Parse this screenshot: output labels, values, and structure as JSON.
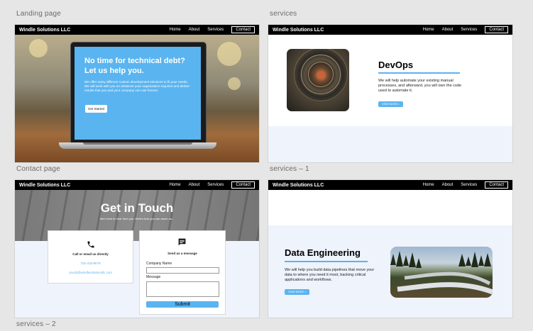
{
  "labels": {
    "landing": "Landing page",
    "services": "services",
    "contact": "Contact page",
    "services1": "services – 1",
    "services2": "services – 2"
  },
  "nav": {
    "brand": "Windle Solutions LLC",
    "home": "Home",
    "about": "About",
    "services": "Services",
    "contact": "Contact"
  },
  "landing": {
    "heading": "No time for technical debt? Let us help you.",
    "body": "We offer many different custom development solutions to fit your needs. We will work with you on whatever your organization requires and deliver results that you and your company can use forever.",
    "button": "Get Started"
  },
  "devops": {
    "title": "DevOps",
    "body": "We will help automate your existing manual processes, and afterward, you will own the code used to automate it.",
    "button": "VIEW MORE >"
  },
  "contact": {
    "title": "Get in Touch",
    "subtitle": "We'd love to hear from you. Here's how you can reach us...",
    "call_title": "Call or email us directly",
    "phone": "702-418-9679",
    "email": "Jacob@windlesolutionsllc.com",
    "message_title": "Send us a message",
    "company_label": "Company Name",
    "message_label": "Message",
    "submit": "Submit"
  },
  "data_engineering": {
    "title": "Data Engineering",
    "body": "We will help you build data pipelines that move your data to where you need it most, backing critical applications and workflows.",
    "button": "VIEW MORE >"
  },
  "colors": {
    "accent": "#5ab4f0",
    "nav_bg": "#000000",
    "light_band": "#eef3fc",
    "canvas": "#e6e6e6"
  }
}
